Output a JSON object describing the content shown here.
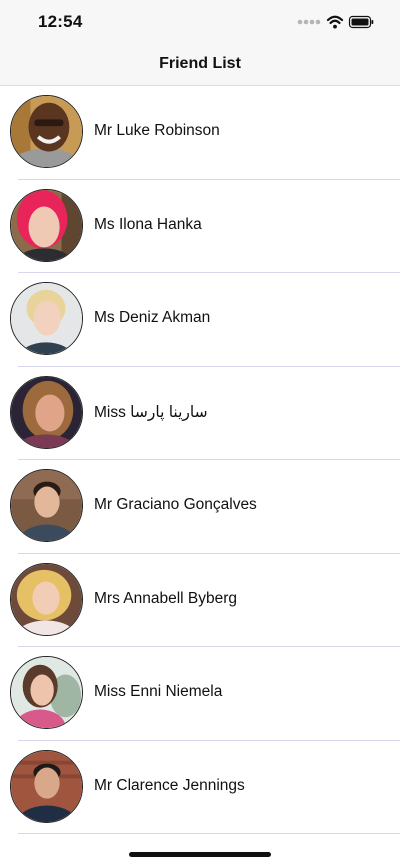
{
  "status_bar": {
    "time": "12:54",
    "icons": [
      "signal-dots-icon",
      "wifi-icon",
      "battery-icon"
    ]
  },
  "navigation": {
    "title": "Friend List"
  },
  "friends": [
    {
      "name": "Mr Luke Robinson",
      "avatar": "avatar-photo"
    },
    {
      "name": "Ms Ilona Hanka",
      "avatar": "avatar-photo"
    },
    {
      "name": "Ms Deniz Akman",
      "avatar": "avatar-photo"
    },
    {
      "name": "Miss سارینا پارسا",
      "avatar": "avatar-photo"
    },
    {
      "name": "Mr Graciano Gonçalves",
      "avatar": "avatar-photo"
    },
    {
      "name": "Mrs Annabell Byberg",
      "avatar": "avatar-photo"
    },
    {
      "name": "Miss Enni Niemela",
      "avatar": "avatar-photo"
    },
    {
      "name": "Mr Clarence Jennings",
      "avatar": "avatar-photo"
    }
  ],
  "colors": {
    "bar_background": "#f7f7f7",
    "separator": "#d9d6ee",
    "text": "#111111"
  }
}
